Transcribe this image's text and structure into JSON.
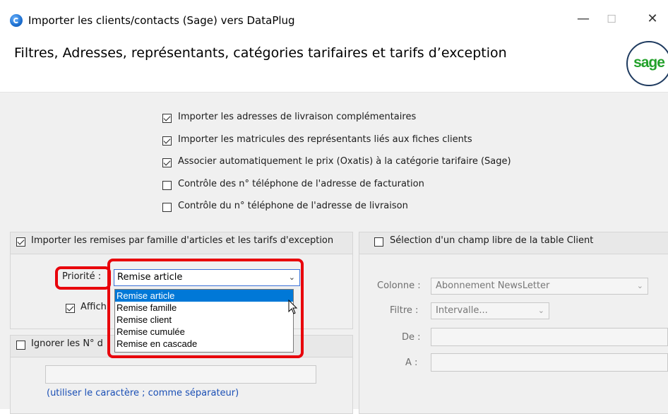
{
  "window": {
    "title": "Importer les clients/contacts (Sage) vers DataPlug",
    "minimize": "—",
    "maximize": "☐",
    "close": "✕"
  },
  "header": {
    "title": "Filtres, Adresses, représentants, catégories tarifaires et tarifs d’exception",
    "logo_text": "sage"
  },
  "options": [
    {
      "label": "Importer les adresses de livraison complémentaires",
      "checked": true
    },
    {
      "label": "Importer les matricules des représentants liés aux fiches clients",
      "checked": true
    },
    {
      "label": "Associer automatiquement le prix (Oxatis) à la catégorie tarifaire (Sage)",
      "checked": true
    },
    {
      "label": "Contrôle des n° téléphone de l'adresse de facturation",
      "checked": false
    },
    {
      "label": "Contrôle du n° téléphone de l'adresse de livraison",
      "checked": false
    }
  ],
  "remises_group": {
    "label": "Importer les remises par famille d'articles et les tarifs d'exception",
    "checked": true,
    "priorite_label": "Priorité :",
    "priorite_value": "Remise article",
    "dropdown_options": [
      "Remise article",
      "Remise famille",
      "Remise client",
      "Remise cumulée",
      "Remise en cascade"
    ],
    "selected_index": 0,
    "affich_label": "Affich",
    "affich_checked": true
  },
  "ignorer_group": {
    "label": "Ignorer les N° d",
    "checked": false,
    "hint": "(utiliser le caractère ; comme séparateur)"
  },
  "champ_libre_group": {
    "label": "Sélection d'un champ libre de la table Client",
    "checked": false,
    "colonne_label": "Colonne :",
    "colonne_value": "Abonnement NewsLetter",
    "filtre_label": "Filtre :",
    "filtre_value": "Intervalle...",
    "de_label": "De :",
    "a_label": "A :"
  },
  "colors": {
    "highlight": "#e8000b",
    "selection": "#0078d7",
    "hint": "#1a4fb5"
  }
}
